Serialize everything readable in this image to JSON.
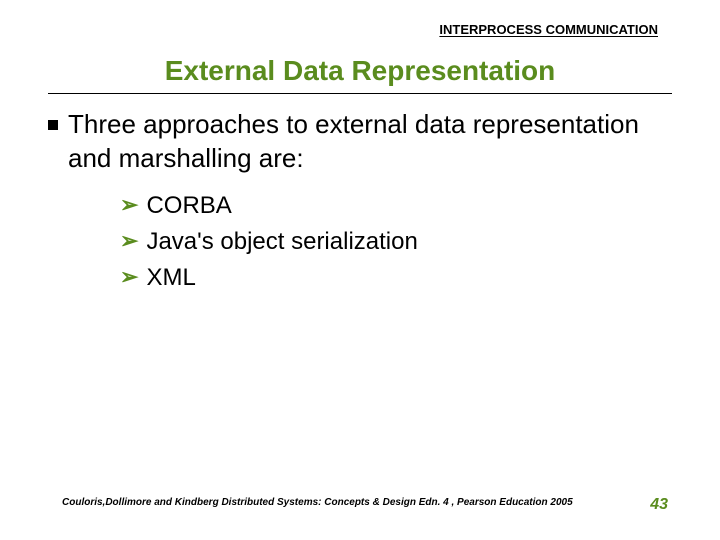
{
  "header": {
    "topic": "INTERPROCESS COMMUNICATION"
  },
  "title": "External Data Representation",
  "main_bullet": "Three approaches to external data representation and marshalling are:",
  "sub_items": [
    "CORBA",
    "Java's object serialization",
    "XML"
  ],
  "footer": {
    "citation": "Couloris,Dollimore and Kindberg  Distributed Systems: Concepts & Design  Edn. 4 , Pearson Education 2005",
    "page_number": "43"
  }
}
